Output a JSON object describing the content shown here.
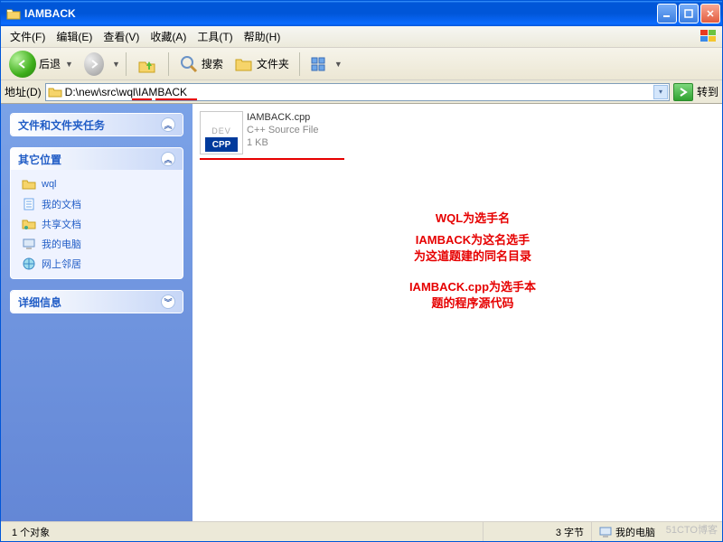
{
  "title": "IAMBACK",
  "menu": {
    "file": "文件(F)",
    "edit": "编辑(E)",
    "view": "查看(V)",
    "fav": "收藏(A)",
    "tools": "工具(T)",
    "help": "帮助(H)"
  },
  "toolbar": {
    "back": "后退",
    "search": "搜索",
    "folders": "文件夹"
  },
  "addr": {
    "label": "地址(D)",
    "path": "D:\\new\\src\\wql\\IAMBACK",
    "go": "转到"
  },
  "sidebar": {
    "tasks_title": "文件和文件夹任务",
    "other_title": "其它位置",
    "other": [
      {
        "icon": "folder",
        "label": "wql"
      },
      {
        "icon": "docs",
        "label": "我的文档"
      },
      {
        "icon": "shared",
        "label": "共享文档"
      },
      {
        "icon": "pc",
        "label": "我的电脑"
      },
      {
        "icon": "net",
        "label": "网上邻居"
      }
    ],
    "details_title": "详细信息"
  },
  "file": {
    "name": "IAMBACK.cpp",
    "type": "C++ Source File",
    "size": "1 KB",
    "badge": "CPP"
  },
  "annotations": {
    "a1": "WQL为选手名",
    "a2": "IAMBACK为这名选手\n为这道题建的同名目录",
    "a3": "IAMBACK.cpp为选手本\n题的程序源代码"
  },
  "status": {
    "left": "1 个对象",
    "mid": "3 字节",
    "right": "我的电脑"
  },
  "watermark": "51CTO博客"
}
